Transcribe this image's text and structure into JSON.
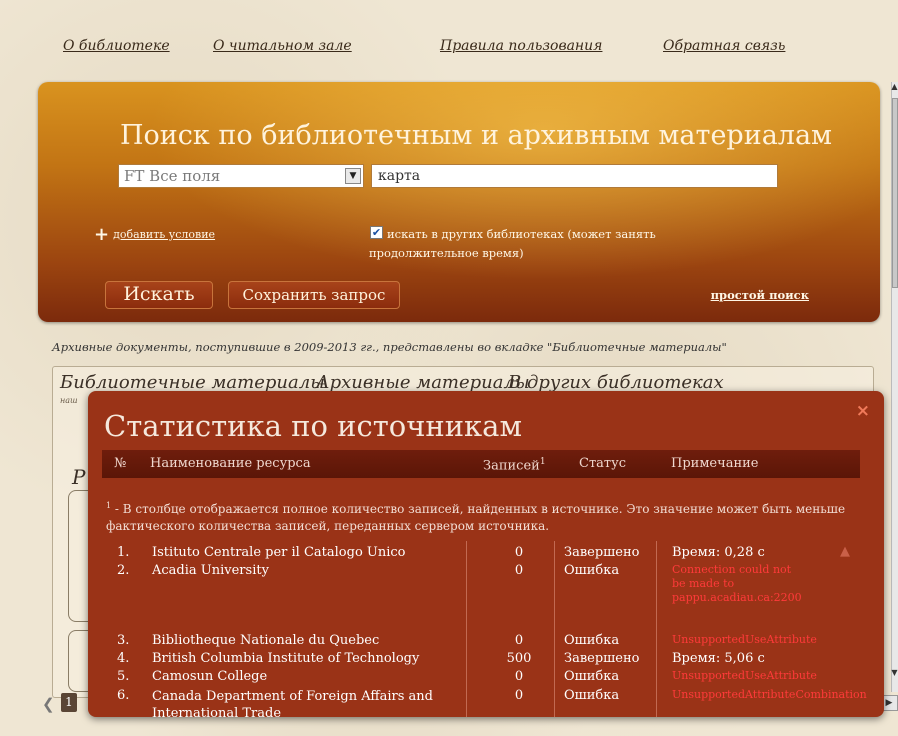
{
  "nav": {
    "items": [
      "О библиотеке",
      "О читальном зале",
      "Правила пользования",
      "Обратная связь"
    ]
  },
  "search": {
    "title": "Поиск по библиотечным и архивным материалам",
    "field_value": "FT Все поля",
    "query_value": "карта",
    "add_condition": "добавить условие",
    "other_libs_label": "искать в других библиотеках (может занять продолжительное время)",
    "other_libs_checked": true,
    "search_button": "Искать",
    "save_button": "Сохранить запрос",
    "simple_search": "простой поиск"
  },
  "notice": "Архивные документы, поступившие в 2009-2013 гг., представлены во вкладке \"Библиотечные материалы\"",
  "tabs": [
    "Библиотечные материалы",
    "Архивные материалы",
    "В других библиотеках"
  ],
  "tab_sub": "наш",
  "background_heading": "Р",
  "pager": {
    "current": "1"
  },
  "modal": {
    "title": "Статистика по источникам",
    "close": "×",
    "columns": {
      "num": "№",
      "name": "Наименование ресурса",
      "count": "Записей",
      "count_sup": "1",
      "status": "Статус",
      "note": "Примечание"
    },
    "footnote_sup": "1",
    "footnote": " - В столбце отображается полное количество записей, найденных в источнике. Это значение может быть меньше фактического количества записей, переданных сервером источника.",
    "rows": [
      {
        "num": "1.",
        "name": "Istituto Centrale per il Catalogo Unico",
        "count": "0",
        "status": "Завершено",
        "note": "Время: 0,28 с",
        "error": false
      },
      {
        "num": "2.",
        "name": "Acadia University",
        "count": "0",
        "status": "Ошибка",
        "note": "Connection could not be made to pappu.acadiau.ca:2200",
        "error": true
      },
      {
        "num": "3.",
        "name": "Bibliotheque Nationale du Quebec",
        "count": "0",
        "status": "Ошибка",
        "note": "UnsupportedUseAttribute",
        "error": true
      },
      {
        "num": "4.",
        "name": "British Columbia Institute of Technology",
        "count": "500",
        "status": "Завершено",
        "note": "Время: 5,06 с",
        "error": false
      },
      {
        "num": "5.",
        "name": "Camosun College",
        "count": "0",
        "status": "Ошибка",
        "note": "UnsupportedUseAttribute",
        "error": true
      },
      {
        "num": "6.",
        "name": "Canada Department of Foreign Affairs and International Trade",
        "count": "0",
        "status": "Ошибка",
        "note": "UnsupportedAttributeCombination",
        "error": true
      }
    ]
  }
}
